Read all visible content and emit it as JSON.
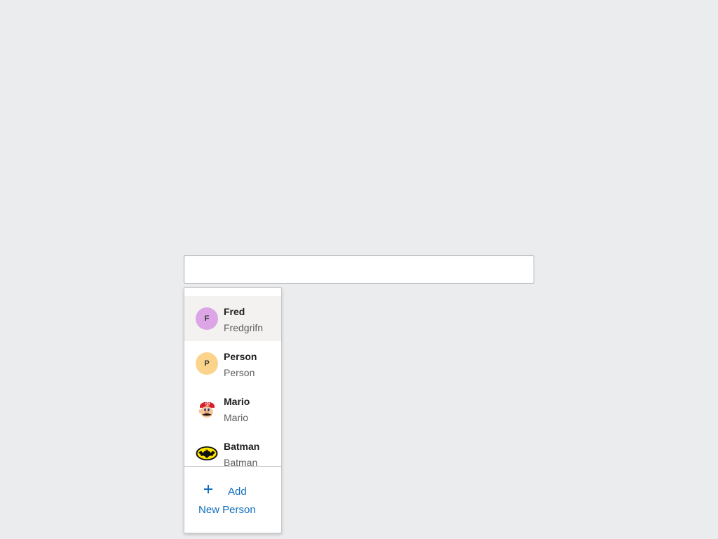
{
  "search": {
    "value": "",
    "placeholder": ""
  },
  "suggestions": [
    {
      "initial": "F",
      "name": "Fred",
      "secondary": "Fredgrifn",
      "avatar_color": "#dba5e6",
      "avatar_type": "initial-icon",
      "highlighted": true
    },
    {
      "initial": "P",
      "name": "Person",
      "secondary": "Person",
      "avatar_color": "#fbd38a",
      "avatar_type": "initial-icon",
      "highlighted": false
    },
    {
      "initial": "",
      "name": "Mario",
      "secondary": "Mario",
      "avatar_color": "#ffffff",
      "avatar_type": "mario-icon",
      "highlighted": false
    },
    {
      "initial": "",
      "name": "Batman",
      "secondary": "Batman",
      "avatar_color": "#ffffff",
      "avatar_type": "batman-icon",
      "highlighted": false
    }
  ],
  "footer": {
    "add_line1": "Add",
    "add_line2": "New Person",
    "icon": "plus-icon",
    "accent_color": "#106ebe"
  }
}
